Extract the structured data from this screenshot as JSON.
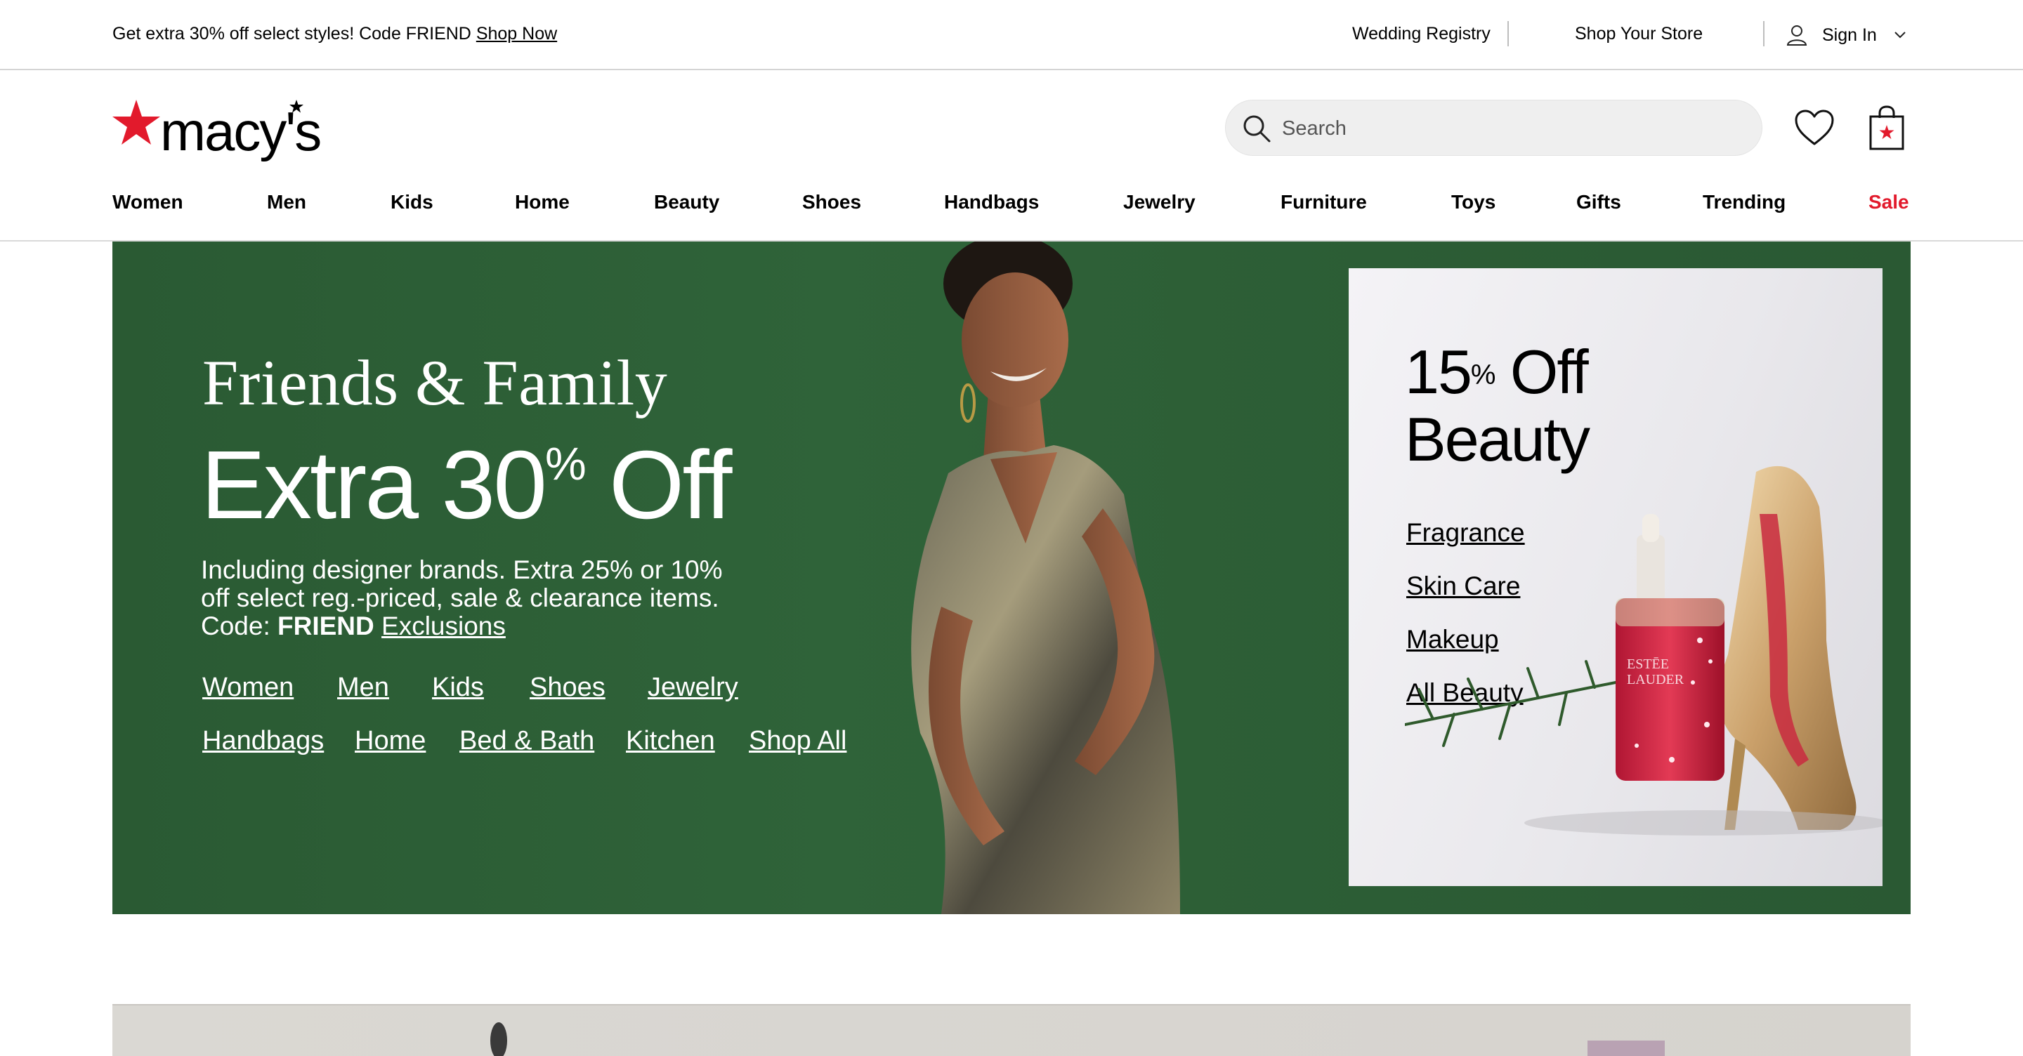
{
  "utility_bar": {
    "promo_text": "Get extra 30% off select styles! Code FRIEND",
    "promo_link": "Shop Now",
    "wedding_registry": "Wedding Registry",
    "shop_your_store": "Shop Your Store",
    "sign_in": "Sign In"
  },
  "header": {
    "logo_text": "macy's",
    "search_placeholder": "Search",
    "brand_color": "#e21a2c"
  },
  "nav": {
    "items": [
      "Women",
      "Men",
      "Kids",
      "Home",
      "Beauty",
      "Shoes",
      "Handbags",
      "Jewelry",
      "Furniture",
      "Toys",
      "Gifts",
      "Trending",
      "Sale"
    ]
  },
  "hero": {
    "subtitle": "Friends & Family",
    "headline_prefix": "Extra 30",
    "headline_pct": "%",
    "headline_suffix": " Off",
    "desc_line1": "Including designer brands. Extra 25% or 10%",
    "desc_line2": "off select reg.-priced, sale & clearance items.",
    "code_label": "Code:",
    "code_value": "FRIEND",
    "exclusions": "Exclusions",
    "links_row1": [
      "Women",
      "Men",
      "Kids",
      "Shoes",
      "Jewelry"
    ],
    "links_row2": [
      "Handbags",
      "Home",
      "Bed & Bath",
      "Kitchen",
      "Shop All"
    ],
    "background_color": "#2d5e36"
  },
  "beauty_card": {
    "pct_number": "15",
    "pct_symbol": "%",
    "off": " Off",
    "category": "Beauty",
    "links": [
      "Fragrance",
      "Skin Care",
      "Makeup",
      "All Beauty"
    ]
  },
  "icons": [
    "user-icon",
    "chevron-down-icon",
    "search-icon",
    "heart-icon",
    "shopping-bag-icon"
  ]
}
